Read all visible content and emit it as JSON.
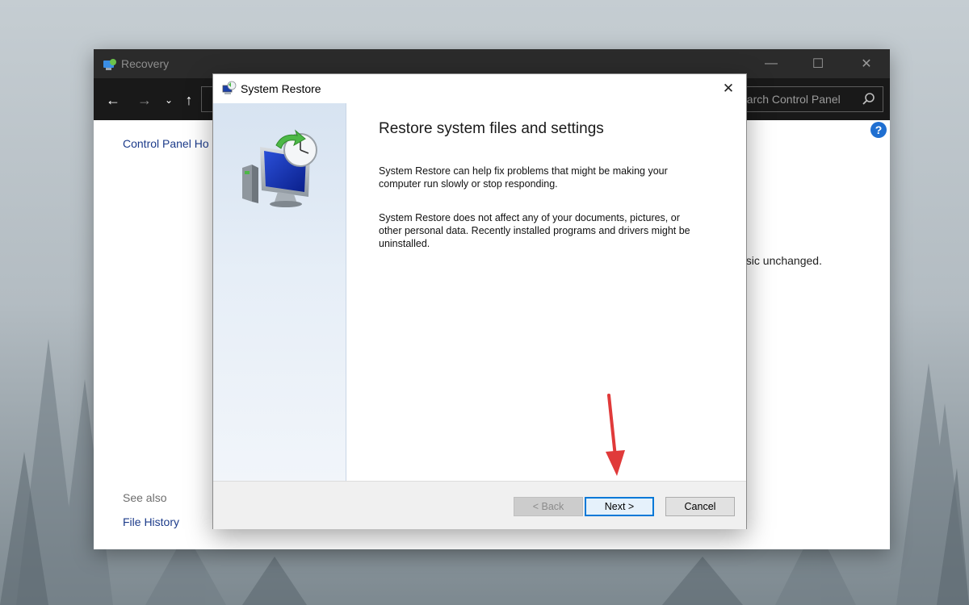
{
  "recovery_window": {
    "title": "Recovery",
    "search_placeholder": "earch Control Panel",
    "left_nav_link": "Control Panel Ho",
    "see_also_label": "See also",
    "file_history_link": "File History",
    "body_fragment": "usic unchanged."
  },
  "dialog": {
    "title": "System Restore",
    "heading": "Restore system files and settings",
    "para1_line1": "System Restore can help fix problems that might be making your",
    "para1_line2": "computer run slowly or stop responding.",
    "para2_line1": "System Restore does not affect any of your documents, pictures, or",
    "para2_line2": "other personal data. Recently installed programs and drivers might be",
    "para2_line3": "uninstalled.",
    "buttons": {
      "back": "< Back",
      "next": "Next >",
      "cancel": "Cancel"
    }
  },
  "colors": {
    "accent_blue": "#0078d7",
    "annotation_red": "#e03a3a",
    "titlebar_dark": "#2b2b2b"
  },
  "icons": [
    "control-panel-icon",
    "back-arrow-icon",
    "forward-arrow-icon",
    "recent-dropdown-icon",
    "up-arrow-icon",
    "search-icon",
    "help-icon",
    "system-restore-icon",
    "close-icon",
    "minimize-icon",
    "maximize-icon"
  ]
}
